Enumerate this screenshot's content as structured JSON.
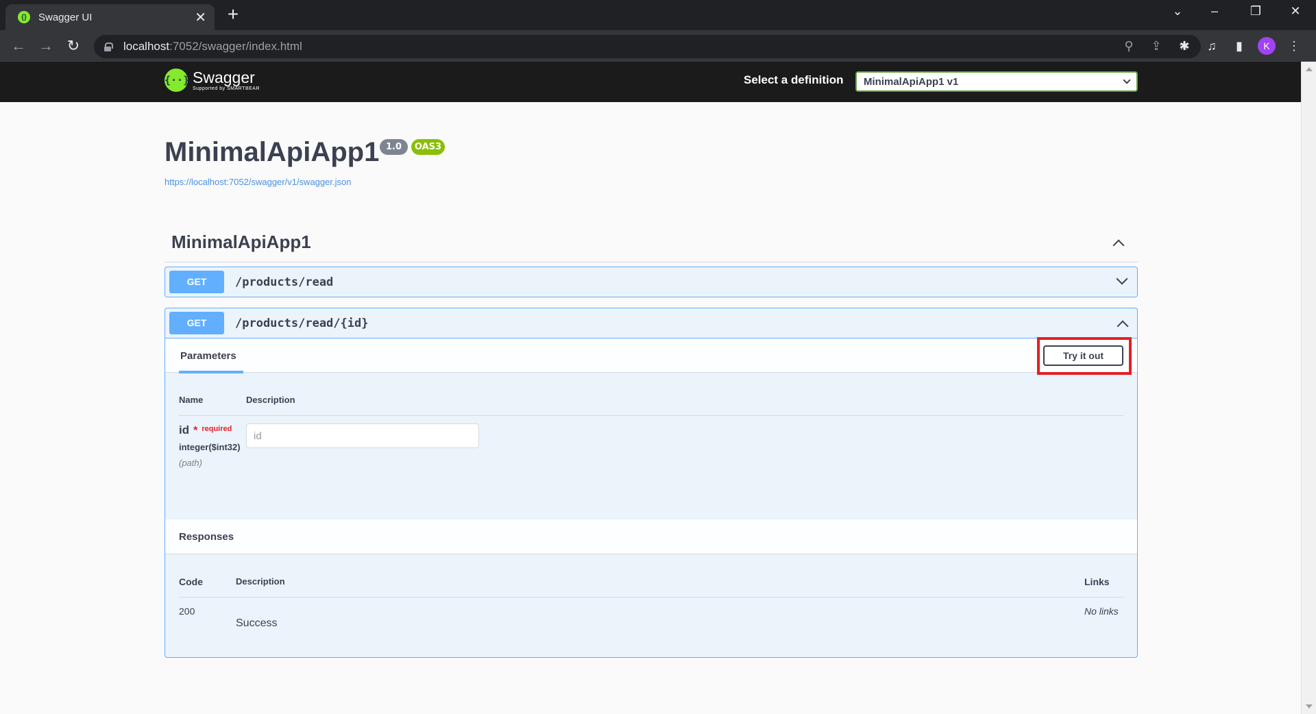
{
  "browser": {
    "tab_title": "Swagger UI",
    "tab_close": "✕",
    "new_tab": "+",
    "url_host": "localhost",
    "url_rest": ":7052/swagger/index.html",
    "avatar_letter": "K"
  },
  "swagger": {
    "logo_mark": "{··}",
    "logo_name": "Swagger",
    "logo_sub": "Supported by SMARTBEAR",
    "definition_label": "Select a definition",
    "definition_value": "MinimalApiApp1 v1"
  },
  "info": {
    "title": "MinimalApiApp1",
    "version": "1.0",
    "oas": "OAS3",
    "url": "https://localhost:7052/swagger/v1/swagger.json"
  },
  "tag": {
    "name": "MinimalApiApp1"
  },
  "operations": [
    {
      "method": "GET",
      "path": "/products/read"
    },
    {
      "method": "GET",
      "path": "/products/read/{id}"
    }
  ],
  "expanded": {
    "parameters_tab": "Parameters",
    "try_it_out": "Try it out",
    "params_header_name": "Name",
    "params_header_description": "Description",
    "param": {
      "name": "id",
      "required_star": "*",
      "required_label": "required",
      "type": "integer($int32)",
      "in": "(path)",
      "placeholder": "id"
    },
    "responses_title": "Responses",
    "resp_header_code": "Code",
    "resp_header_description": "Description",
    "resp_header_links": "Links",
    "response": {
      "code": "200",
      "description": "Success",
      "links": "No links"
    }
  }
}
